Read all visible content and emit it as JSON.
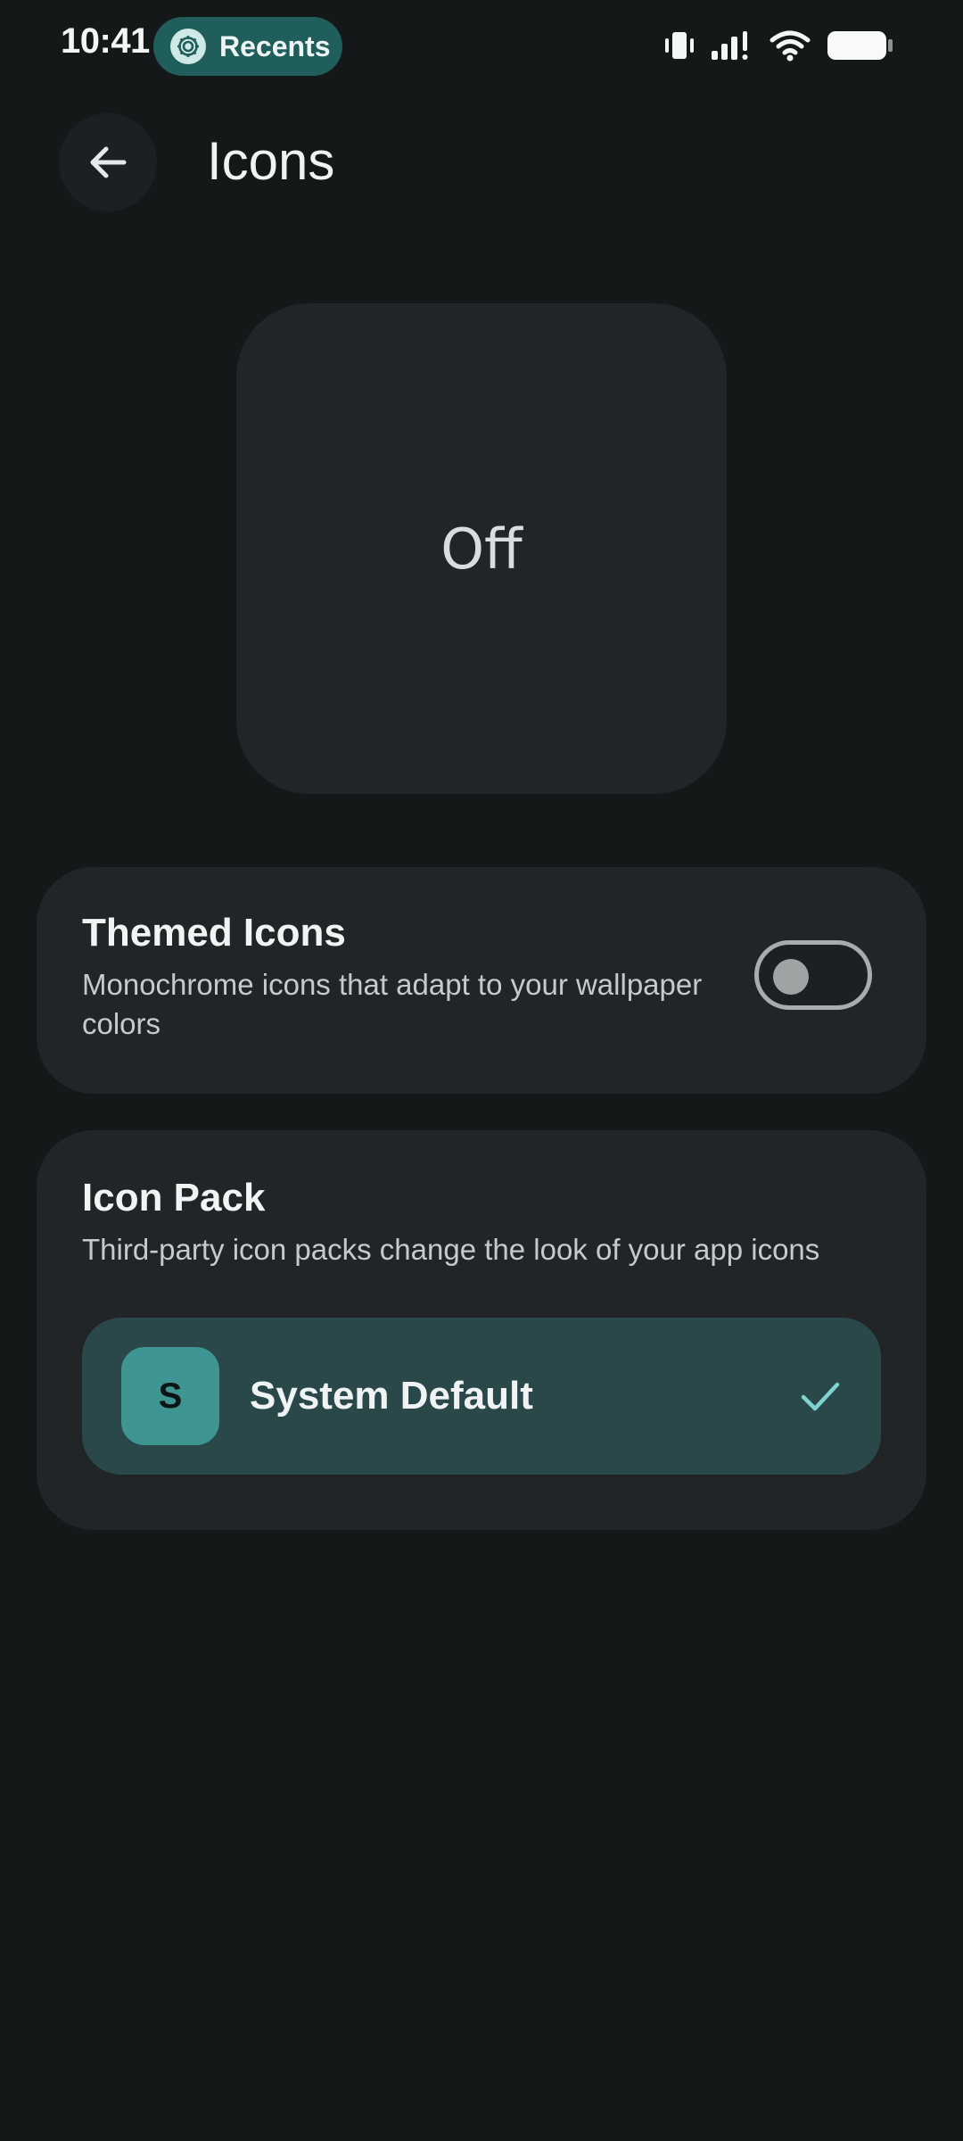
{
  "status_bar": {
    "time": "10:41",
    "pill_label": "Recents",
    "pill_icon": "gear-icon",
    "icons": [
      "vibrate-icon",
      "signal-icon",
      "wifi-icon",
      "battery-icon"
    ]
  },
  "app_bar": {
    "back_icon": "arrow-back-icon",
    "title": "Icons"
  },
  "preview": {
    "state_text": "Off"
  },
  "themed_icons": {
    "title": "Themed Icons",
    "description": "Monochrome icons that adapt to your wallpaper colors",
    "toggle_on": false
  },
  "icon_pack": {
    "title": "Icon Pack",
    "description": "Third-party icon packs change the look of your app icons",
    "options": [
      {
        "letter": "S",
        "label": "System Default",
        "selected": true
      }
    ]
  },
  "colors": {
    "background": "#151819",
    "card": "#212527",
    "accent_pill": "#1f5e5b",
    "selected_row": "#2a4749",
    "letter_tile": "#3f9592",
    "check": "#7fd3cf"
  }
}
